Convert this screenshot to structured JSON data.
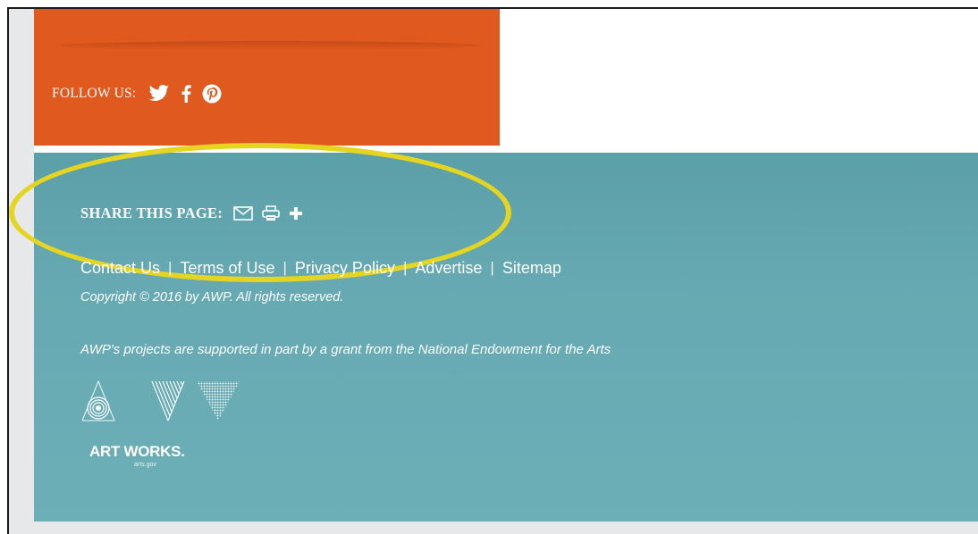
{
  "follow": {
    "label": "FOLLOW US:",
    "icons": [
      "twitter-icon",
      "facebook-icon",
      "pinterest-icon"
    ]
  },
  "share": {
    "label": "SHARE THIS PAGE:",
    "icons": [
      "email-icon",
      "print-icon",
      "plus-icon"
    ]
  },
  "footer_links": {
    "contact": "Contact Us",
    "terms": "Terms of Use",
    "privacy": "Privacy Policy",
    "advertise": "Advertise",
    "sitemap": "Sitemap",
    "separator": "|"
  },
  "copyright": "Copyright © 2016 by AWP. All rights reserved.",
  "grant_text": "AWP's projects are supported in part by a grant from the National Endowment for the Arts",
  "logo": {
    "title": "ART WORKS.",
    "subtitle": "arts.gov"
  },
  "colors": {
    "follow_bg": "#e0591f",
    "footer_bg": "#66a9b2",
    "highlight": "#e5d420",
    "text": "#ffffff"
  }
}
